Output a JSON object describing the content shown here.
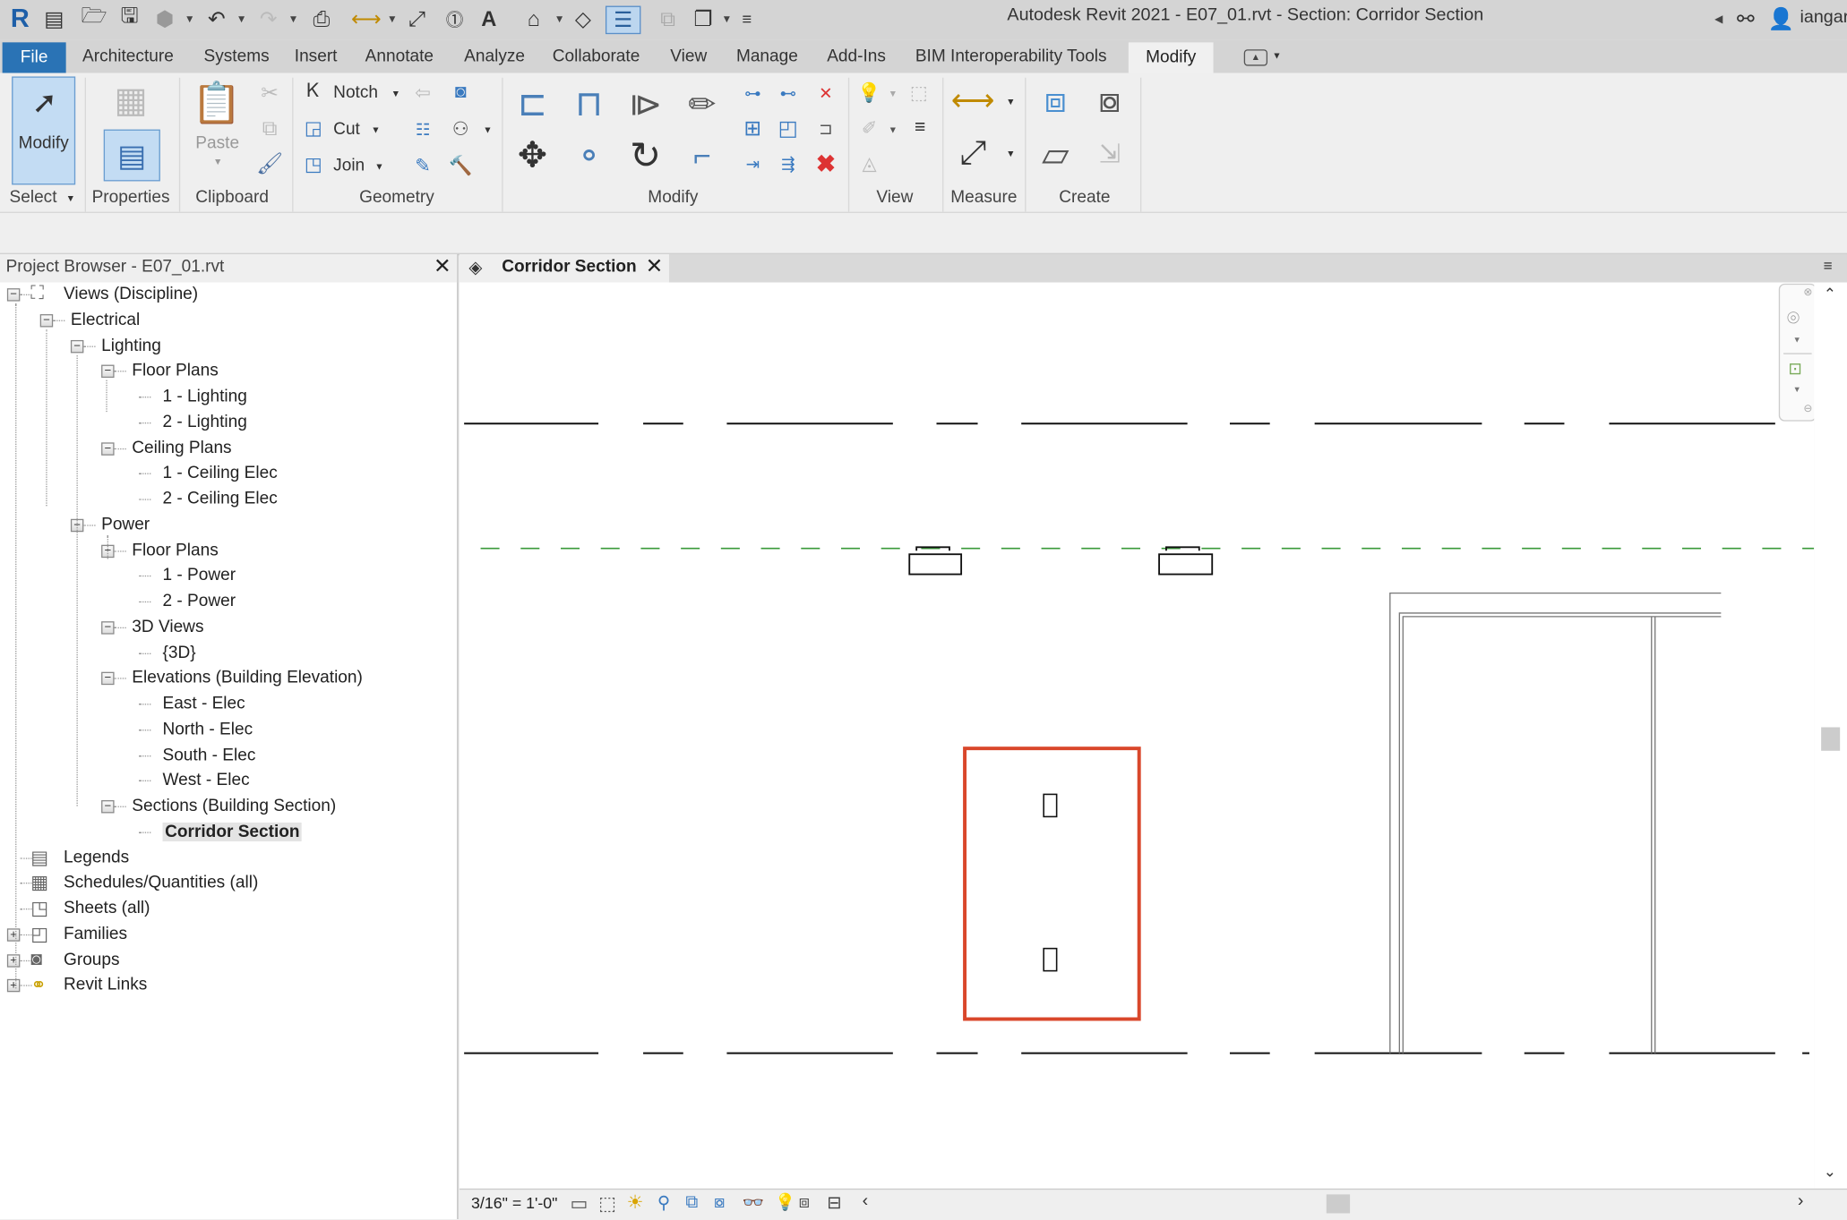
{
  "window": {
    "title": "Autodesk Revit 2021 - E07_01.rvt - Section: Corridor Section",
    "user": "iangar"
  },
  "quick_access": [
    {
      "name": "revit-logo",
      "glyph": "R"
    },
    {
      "name": "home-icon",
      "glyph": "▤"
    },
    {
      "name": "open-icon",
      "glyph": "📂"
    },
    {
      "name": "save-icon",
      "glyph": "💾"
    },
    {
      "name": "sync-icon",
      "glyph": "⬡"
    },
    {
      "name": "undo-icon",
      "glyph": "↶"
    },
    {
      "name": "redo-icon",
      "glyph": "↷"
    },
    {
      "name": "print-icon",
      "glyph": "🖶"
    },
    {
      "name": "measure-icon",
      "glyph": "⟷"
    },
    {
      "name": "aligned-dimension-icon",
      "glyph": "⤢"
    },
    {
      "name": "tag-icon",
      "glyph": "⓵"
    },
    {
      "name": "text-icon",
      "glyph": "A"
    },
    {
      "name": "3d-view-icon",
      "glyph": "⌂"
    },
    {
      "name": "section-icon",
      "glyph": "◇"
    },
    {
      "name": "thin-lines-icon",
      "glyph": "☰"
    },
    {
      "name": "close-hidden-icon",
      "glyph": "⧉"
    },
    {
      "name": "switch-windows-icon",
      "glyph": "❐"
    },
    {
      "name": "customize-qat-icon",
      "glyph": "≡"
    }
  ],
  "menu_tabs": [
    "File",
    "Architecture",
    "Systems",
    "Insert",
    "Annotate",
    "Analyze",
    "Collaborate",
    "View",
    "Manage",
    "Add-Ins",
    "BIM Interoperability Tools",
    "Modify"
  ],
  "active_tab": "Modify",
  "ribbon": {
    "panels": [
      "Select",
      "Properties",
      "Clipboard",
      "Geometry",
      "Modify",
      "View",
      "Measure",
      "Create"
    ],
    "modify_button": "Modify",
    "paste_button": "Paste",
    "notch_button": "Notch",
    "cut_button": "Cut",
    "join_button": "Join"
  },
  "project_browser": {
    "title": "Project Browser - E07_01.rvt",
    "tree": [
      {
        "label": "Views (Discipline)",
        "level": 0,
        "toggle": "minus",
        "icon": "views-icon"
      },
      {
        "label": "Electrical",
        "level": 1,
        "toggle": "minus"
      },
      {
        "label": "Lighting",
        "level": 2,
        "toggle": "minus"
      },
      {
        "label": "Floor Plans",
        "level": 3,
        "toggle": "minus"
      },
      {
        "label": "1 - Lighting",
        "level": 4
      },
      {
        "label": "2 - Lighting",
        "level": 4
      },
      {
        "label": "Ceiling Plans",
        "level": 3,
        "toggle": "minus"
      },
      {
        "label": "1 - Ceiling Elec",
        "level": 4
      },
      {
        "label": "2 - Ceiling Elec",
        "level": 4
      },
      {
        "label": "Power",
        "level": 2,
        "toggle": "minus"
      },
      {
        "label": "Floor Plans",
        "level": 3,
        "toggle": "minus"
      },
      {
        "label": "1 - Power",
        "level": 4
      },
      {
        "label": "2 - Power",
        "level": 4
      },
      {
        "label": "3D Views",
        "level": 3,
        "toggle": "minus"
      },
      {
        "label": "{3D}",
        "level": 4
      },
      {
        "label": "Elevations (Building Elevation)",
        "level": 3,
        "toggle": "minus"
      },
      {
        "label": "East - Elec",
        "level": 4
      },
      {
        "label": "North - Elec",
        "level": 4
      },
      {
        "label": "South - Elec",
        "level": 4
      },
      {
        "label": "West - Elec",
        "level": 4
      },
      {
        "label": "Sections (Building Section)",
        "level": 3,
        "toggle": "minus"
      },
      {
        "label": "Corridor Section",
        "level": 4,
        "selected": true
      },
      {
        "label": "Legends",
        "level": 0,
        "icon": "legends-icon"
      },
      {
        "label": "Schedules/Quantities (all)",
        "level": 0,
        "icon": "schedules-icon"
      },
      {
        "label": "Sheets (all)",
        "level": 0,
        "icon": "sheets-icon"
      },
      {
        "label": "Families",
        "level": 0,
        "toggle": "plus",
        "icon": "families-icon"
      },
      {
        "label": "Groups",
        "level": 0,
        "toggle": "plus",
        "icon": "groups-icon"
      },
      {
        "label": "Revit Links",
        "level": 0,
        "toggle": "plus",
        "icon": "revit-links-icon"
      }
    ]
  },
  "view": {
    "tab_label": "Corridor Section",
    "scale": "3/16\" = 1'-0\"",
    "selection_color": "#d9472b",
    "level_line_color": "#3a9a3a"
  }
}
